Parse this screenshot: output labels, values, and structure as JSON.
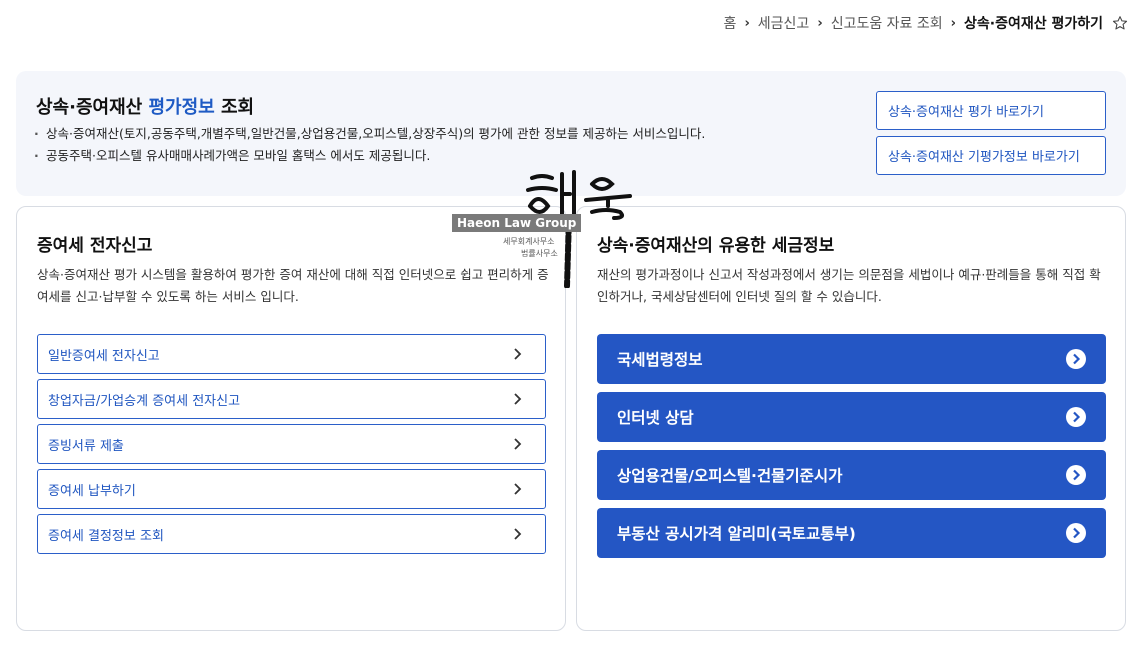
{
  "breadcrumb": {
    "items": [
      "홈",
      "세금신고",
      "신고도움 자료 조회"
    ],
    "current": "상속·증여재산 평가하기",
    "star_icon": "star-outline-icon"
  },
  "banner": {
    "title_prefix": "상속·증여재산 ",
    "title_highlight": "평가정보",
    "title_suffix": " 조회",
    "bullets": [
      "상속·증여재산(토지,공동주택,개별주택,일반건물,상업용건물,오피스텔,상장주식)의 평가에 관한 정보를 제공하는 서비스입니다.",
      "공동주택·오피스텔 유사매매사례가액은 모바일 홈택스 에서도 제공됩니다."
    ],
    "buttons": [
      "상속·증여재산 평가 바로가기",
      "상속·증여재산 기평가정보 바로가기"
    ]
  },
  "left_card": {
    "title": "증여세 전자신고",
    "description": "상속·증여재산 평가 시스템을 활용하여 평가한 증여 재산에 대해 직접 인터넷으로 쉽고 편리하게 증여세를 신고·납부할 수 있도록 하는 서비스 입니다.",
    "links": [
      "일반증여세 전자신고",
      "창업자금/가업승계 증여세 전자신고",
      "증빙서류 제출",
      "증여세 납부하기",
      "증여세 결정정보 조회"
    ]
  },
  "right_card": {
    "title": "상속·증여재산의 유용한 세금정보",
    "description": "재산의 평가과정이나 신고서 작성과정에서 생기는 의문점을 세법이나 예규·판례들을 통해 직접 확인하거나, 국세상담센터에 인터넷 질의 할 수 있습니다.",
    "links": [
      "국세법령정보",
      "인터넷 상담",
      "상업용건물/오피스텔·건물기준시가",
      "부동산 공시가격 알리미(국토교통부)"
    ]
  },
  "watermark": {
    "brand": "Haeon Law Group",
    "line1": "세무회계사무소",
    "line2": "법률사무소",
    "script": "해온"
  },
  "colors": {
    "accent": "#2456c4",
    "outline": "#2b5fc9",
    "banner_bg": "#f4f6fb"
  }
}
